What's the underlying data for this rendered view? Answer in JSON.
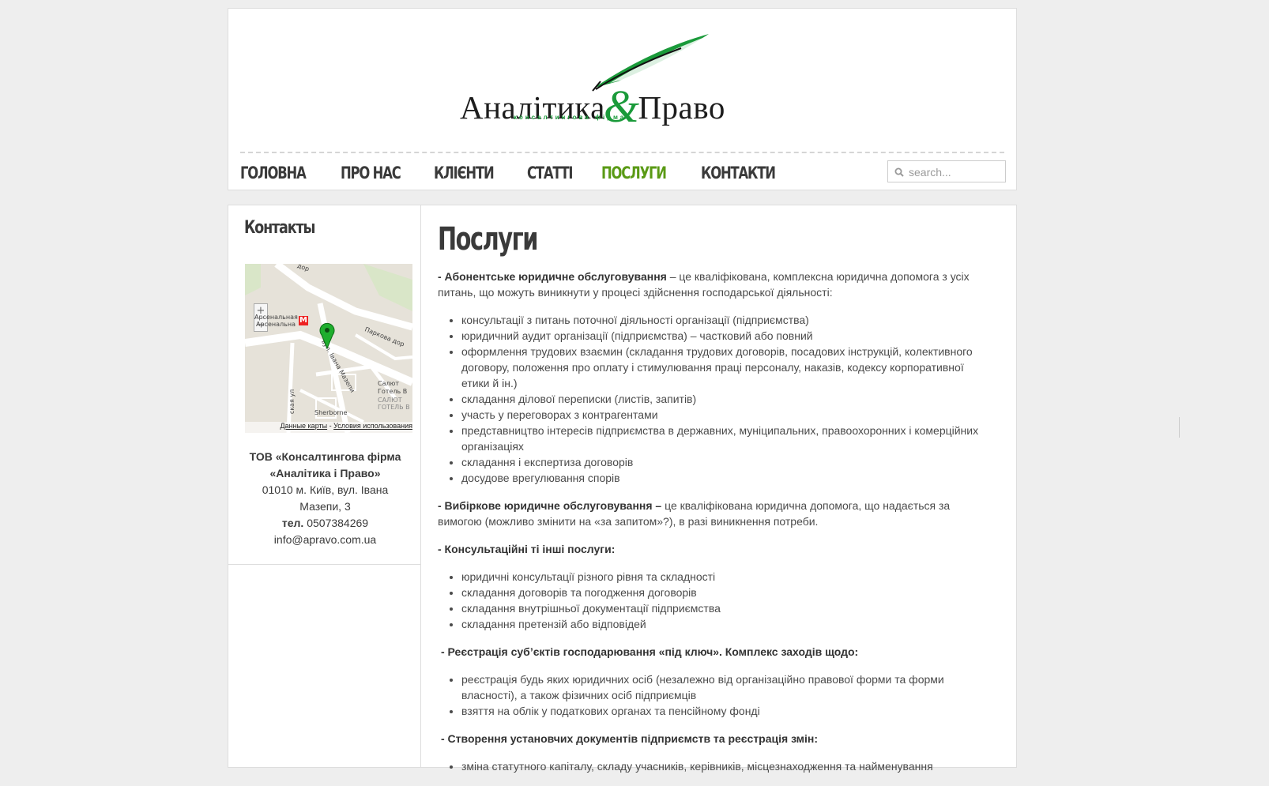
{
  "logo": {
    "name_left": "Аналітика",
    "amp": "&",
    "name_right": "Право",
    "subtitle": "консалтингова фірма"
  },
  "nav": {
    "items": [
      "Головна",
      "Про нас",
      "Клієнти",
      "Статті",
      "Послуги",
      "Контакти"
    ],
    "active": "Послуги"
  },
  "search": {
    "placeholder": "search..."
  },
  "sidebar": {
    "title": "Контакты",
    "map": {
      "labels": {
        "station_ru": "Арсенальная",
        "station_ua": "Арсенальна",
        "park_road": "Паркова дор",
        "street": "вул. Івана Мазепи",
        "hotel1": "Салют",
        "hotel2": "Готель В",
        "hotel3": "САЛЮТ",
        "hotel4": "ГОТЕЛЬ В",
        "sherborne": "Sherborne",
        "street_side": "ская ул",
        "top_road": "дор"
      },
      "footer_data": "Данные карты",
      "footer_sep": " - ",
      "footer_terms": "Условия использования",
      "zoom_in": "+",
      "zoom_out": "−"
    },
    "company_line1": "ТОВ «Консалтингова фірма",
    "company_line2": "«Аналітика і Право»",
    "address_line1": "01010 м. Київ, вул. Івана",
    "address_line2": "Мазепи, 3",
    "tel_label": "тел.",
    "tel": "0507384269",
    "email": "info@apravo.com.ua"
  },
  "content": {
    "title": "Послуги",
    "s1": {
      "lead": "- Абонентське юридичне обслуговування",
      "text": " – це кваліфікована, комплексна юридична допомога з усіх питань, що можуть виникнути у процесі здійснення господарської діяльності:",
      "items": [
        "консультації з питань поточної діяльності організації (підприємства)",
        "юридичний аудит організації (підприємства) – частковий або повний",
        "оформлення трудових взаємин (складання трудових договорів, посадових інструкцій, колективного договору, положення про оплату і стимулювання праці персоналу, наказів, кодексу корпоративної етики й ін.)",
        "складання ділової переписки (листів, запитів)",
        "участь у переговорах з контрагентами",
        "представництво інтересів підприємства в державних, муніципальних, правоохоронних і комерційних організаціях",
        "складання і експертиза договорів",
        "досудове врегулювання спорів"
      ]
    },
    "s2": {
      "lead": "- Вибіркове юридичне обслуговування –",
      "text": " це кваліфікована юридична допомога, що надається за вимогою (можливо змінити на «за запитом»?), в разі виникнення потреби."
    },
    "s3": {
      "lead": "- Консультаційні ті інші послуги:",
      "items": [
        "юридичні консультації різного рівня та складності",
        "складання договорів та погодження договорів",
        "складання внутрішньої документації підприємства",
        "складання претензій або відповідей"
      ]
    },
    "s4": {
      "lead": "- Реєстрація суб’єктів господарювання «під ключ». Комплекс заходів щодо:",
      "items": [
        "реєстрація будь яких юридичних осіб (незалежно від організаційно правової форми та форми власності), а також фізичних осіб підприємців",
        "взяття на облік у податкових органах та пенсійному фонді"
      ]
    },
    "s5": {
      "lead": "- Створення установчих документів підприємств та реєстрація змін:",
      "items": [
        "зміна статутного капіталу, складу учасників, керівників, місцезнаходження та найменування"
      ]
    }
  },
  "colors": {
    "accent_green": "#5a9a15",
    "logo_green": "#1a9a3a",
    "text": "#3a3a3a",
    "background": "#eeeeee"
  }
}
